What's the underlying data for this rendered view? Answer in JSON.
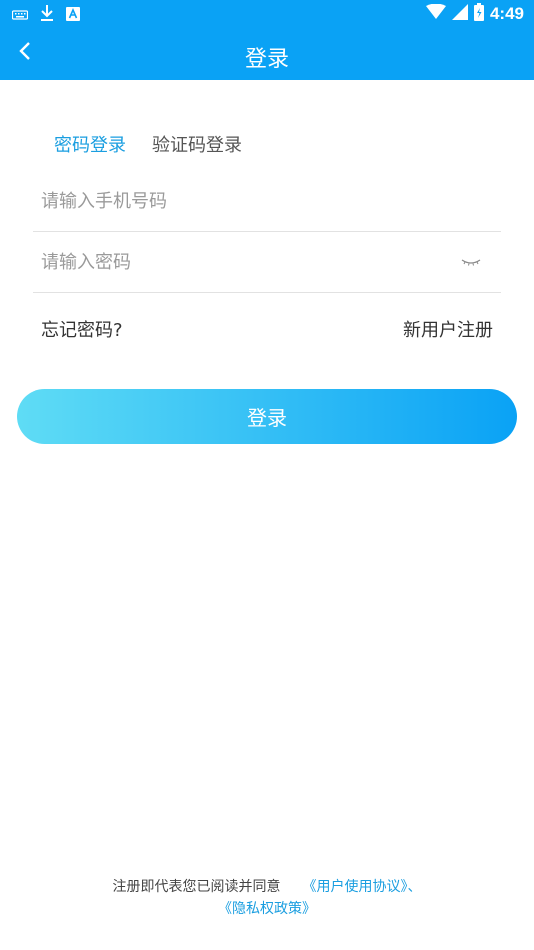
{
  "status_bar": {
    "time": "4:49",
    "icons": [
      "keyboard-icon",
      "download-icon",
      "a-notification-icon",
      "wifi-icon",
      "signal-icon",
      "battery-icon"
    ]
  },
  "header": {
    "title": "登录",
    "back_icon": "chevron-left-icon"
  },
  "tabs": [
    {
      "label": "密码登录",
      "active": true
    },
    {
      "label": "验证码登录",
      "active": false
    }
  ],
  "form": {
    "phone_placeholder": "请输入手机号码",
    "password_placeholder": "请输入密码",
    "password_toggle_icon": "eye-closed-icon"
  },
  "links": {
    "forgot_password": "忘记密码?",
    "register": "新用户注册"
  },
  "login_button": "登录",
  "agreement": {
    "prefix": "注册即代表您已阅读并同意",
    "user_agreement": "《用户使用协议》、",
    "privacy_policy": "《隐私权政策》"
  },
  "colors": {
    "primary": "#0aa2f5",
    "tab_active": "#1a9ee0",
    "gradient_start": "#5fdcf5",
    "gradient_end": "#0aa2f5"
  }
}
